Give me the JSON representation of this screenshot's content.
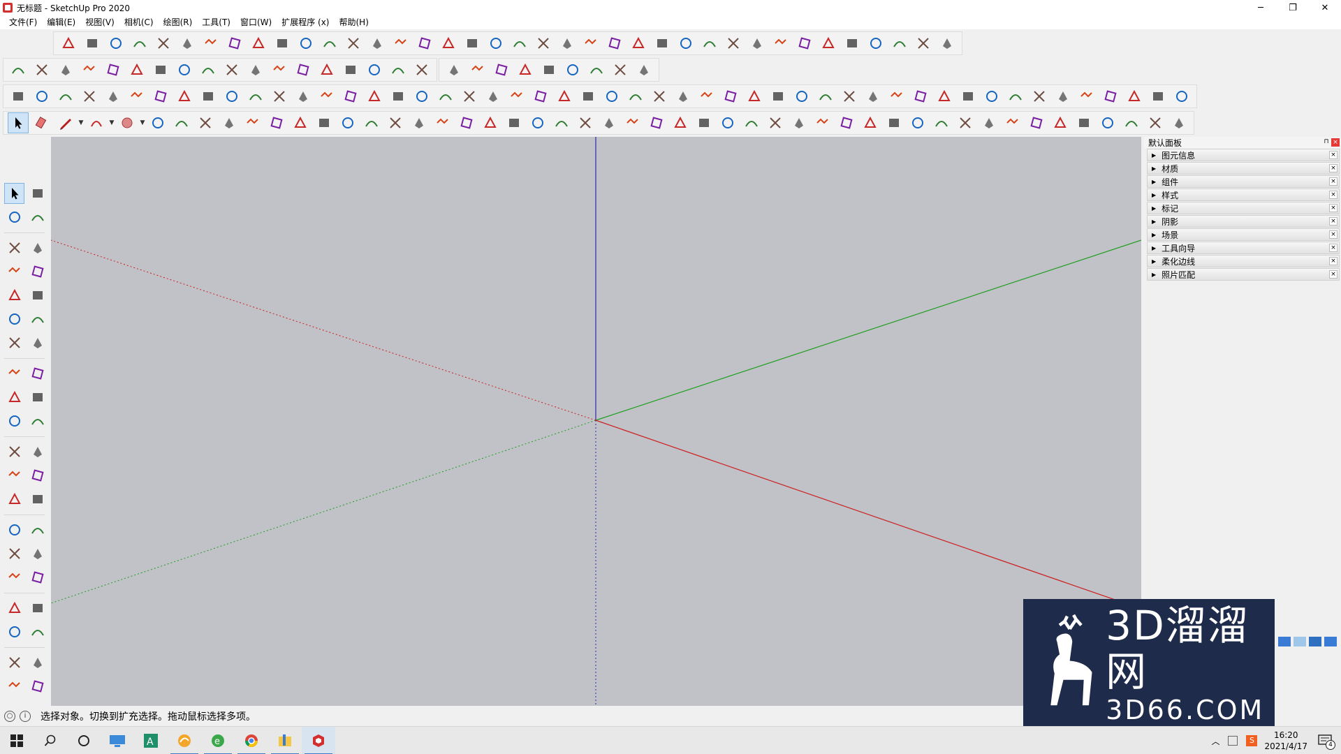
{
  "window": {
    "title": "无标题 - SketchUp Pro 2020",
    "minimize": "─",
    "restore": "❐",
    "close": "✕"
  },
  "menu": [
    "文件(F)",
    "编辑(E)",
    "视图(V)",
    "相机(C)",
    "绘图(R)",
    "工具(T)",
    "窗口(W)",
    "扩展程序 (x)",
    "帮助(H)"
  ],
  "tray": {
    "title": "默认面板",
    "pin": "⊓",
    "close": "×",
    "panels": [
      "图元信息",
      "材质",
      "组件",
      "样式",
      "标记",
      "阴影",
      "场景",
      "工具向导",
      "柔化边线",
      "照片匹配"
    ]
  },
  "status": {
    "text": "选择对象。切换到扩充选择。拖动鼠标选择多项。"
  },
  "taskbar": {
    "time": "16:20",
    "date": "2021/4/17",
    "notification_count": "4"
  },
  "watermark": {
    "brand": "3D溜溜网",
    "site": "3D66.COM"
  },
  "colors": {
    "viewport_bg": "#c0c2c7",
    "axis_red": "#cc1f1f",
    "axis_green": "#1e9e1e",
    "axis_blue": "#2a2aa8",
    "accent_red": "#d32f2f"
  }
}
